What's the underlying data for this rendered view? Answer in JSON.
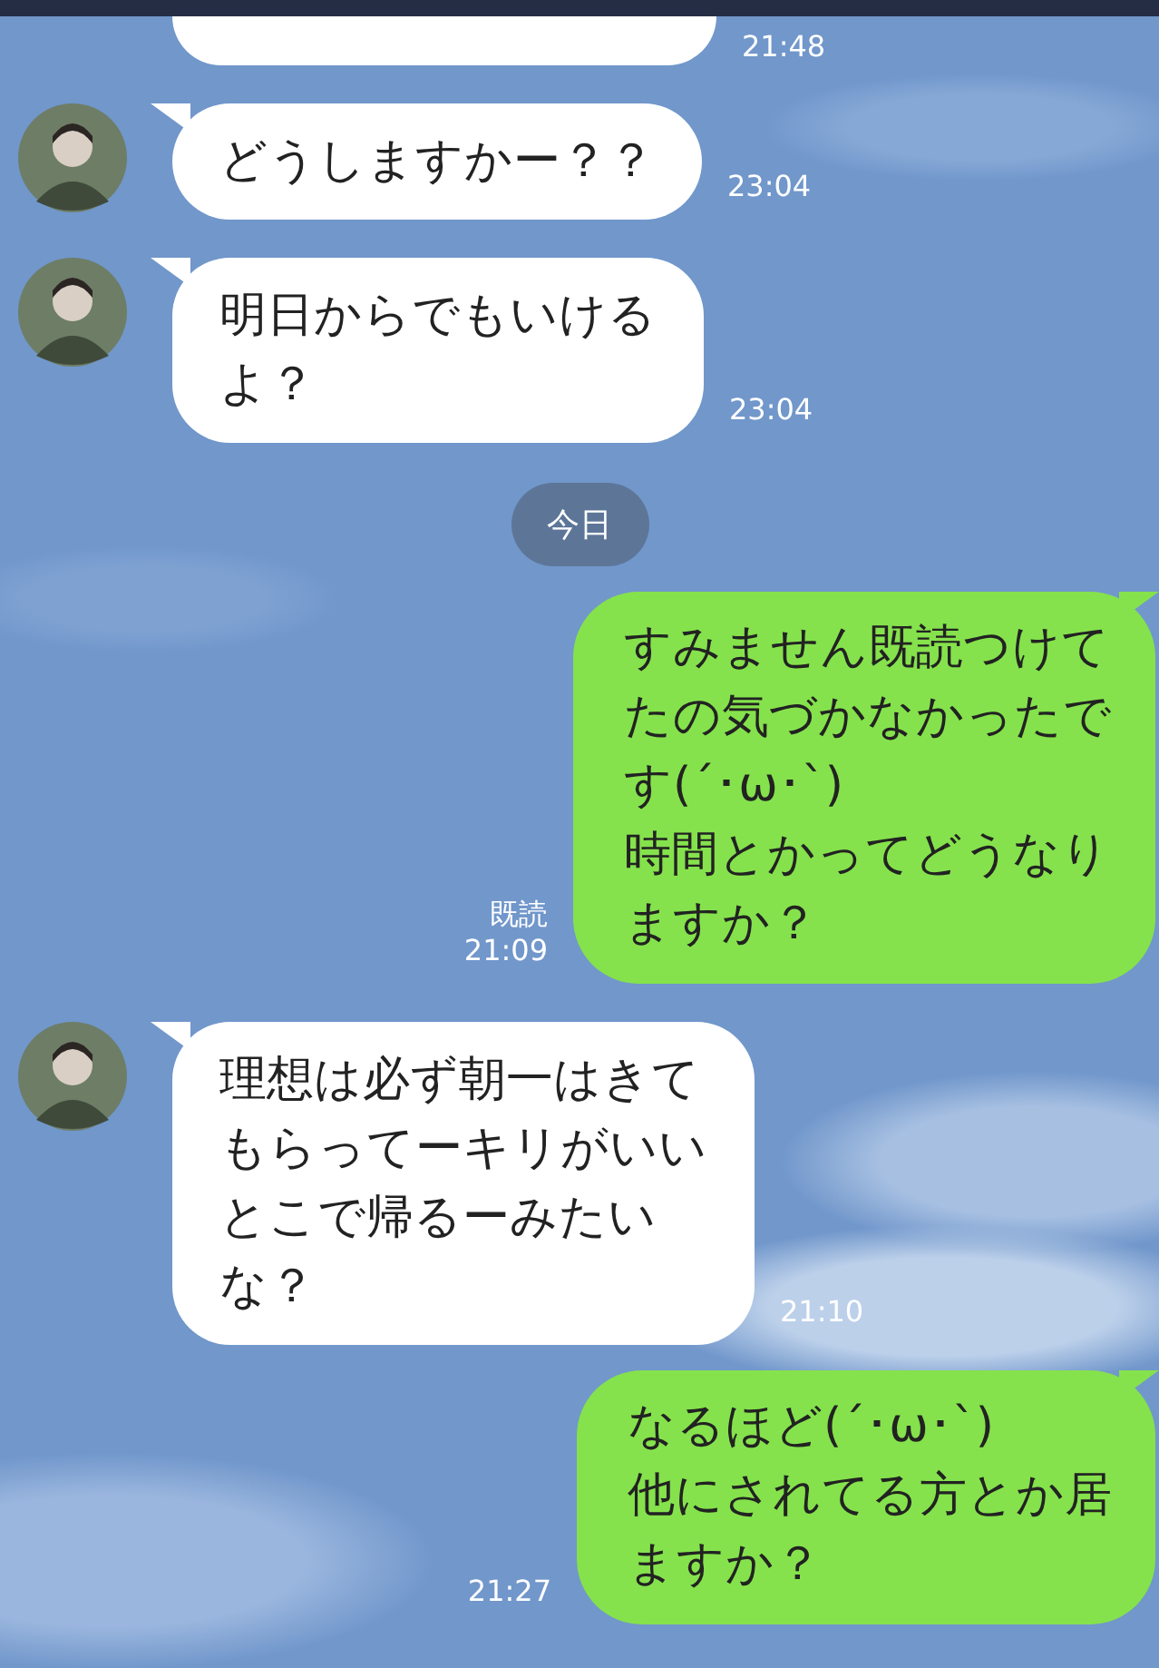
{
  "messages": [
    {
      "kind": "incoming",
      "time": "21:48"
    },
    {
      "kind": "incoming",
      "avatar": true,
      "lines": [
        "どうしますかー？？"
      ],
      "time": "23:04"
    },
    {
      "kind": "incoming",
      "avatar": true,
      "lines": [
        "明日からでもいける",
        "よ？"
      ],
      "time": "23:04"
    },
    {
      "kind": "date",
      "text": "今日"
    },
    {
      "kind": "outgoing",
      "read": "既読",
      "lines": [
        "すみません既読つけて",
        "たの気づかなかったで",
        "す(´･ω･`)",
        "時間とかってどうなり",
        "ますか？"
      ],
      "time": "21:09"
    },
    {
      "kind": "incoming",
      "avatar": true,
      "lines": [
        "理想は必ず朝一はきて",
        "もらってーキリがいい",
        "とこで帰るーみたい",
        "な？"
      ],
      "time": "21:10"
    },
    {
      "kind": "outgoing",
      "lines": [
        "なるほど(´･ω･`)",
        "他にされてる方とか居",
        "ますか？"
      ],
      "time": "21:27"
    }
  ]
}
